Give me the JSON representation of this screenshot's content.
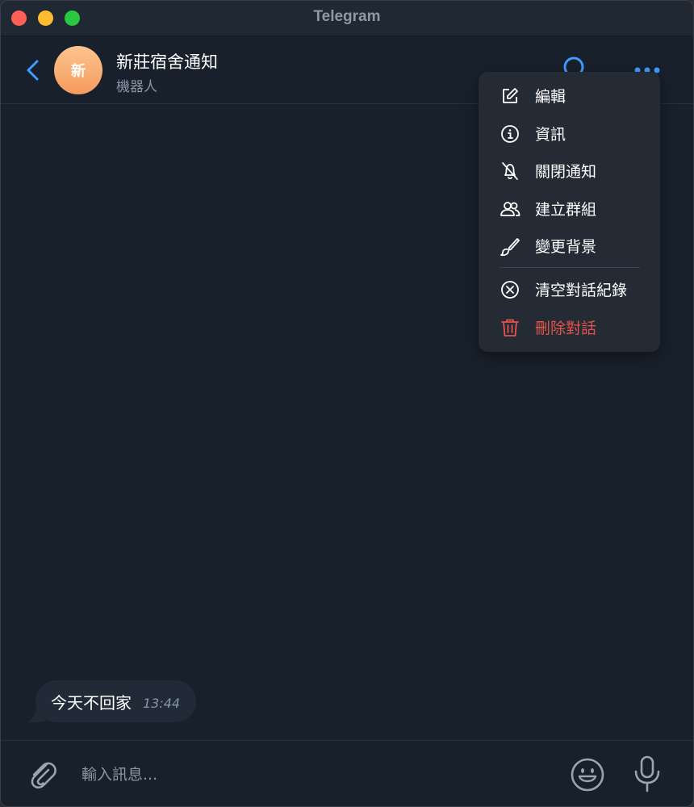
{
  "window": {
    "title": "Telegram"
  },
  "header": {
    "avatar_letter": "新",
    "chat_name": "新莊宿舍通知",
    "status": "機器人"
  },
  "messages": [
    {
      "text": "今天不回家",
      "time": "13:44"
    }
  ],
  "composer": {
    "placeholder": "輸入訊息..."
  },
  "menu": {
    "items": [
      {
        "label": "編輯",
        "icon": "edit-icon"
      },
      {
        "label": "資訊",
        "icon": "info-icon"
      },
      {
        "label": "關閉通知",
        "icon": "bell-off-icon"
      },
      {
        "label": "建立群組",
        "icon": "users-icon"
      },
      {
        "label": "變更背景",
        "icon": "brush-icon"
      },
      {
        "label": "清空對話紀錄",
        "icon": "circle-x-icon"
      },
      {
        "label": "刪除對話",
        "icon": "trash-icon"
      }
    ]
  },
  "colors": {
    "accent": "#3e9bff",
    "danger": "#e5534b",
    "background": "#18202b",
    "menu_background": "#242b35",
    "bubble_background": "#212b37",
    "avatar_gradient_top": "#fcc58e",
    "avatar_gradient_bottom": "#f59a5d"
  }
}
